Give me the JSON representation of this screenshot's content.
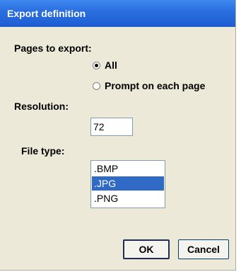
{
  "window": {
    "title": "Export definition"
  },
  "pages": {
    "label": "Pages to export:",
    "options": [
      {
        "label": "All",
        "selected": true
      },
      {
        "label": "Prompt on each page",
        "selected": false
      }
    ]
  },
  "resolution": {
    "label": "Resolution:",
    "value": "72"
  },
  "file_type": {
    "label": "File type:",
    "options": [
      ".BMP",
      ".JPG",
      ".PNG"
    ],
    "selected": ".JPG"
  },
  "buttons": {
    "ok": "OK",
    "cancel": "Cancel"
  },
  "colors": {
    "titlebar": "#2a6fe0",
    "selection": "#316ac5",
    "dialog_bg": "#ece9d8"
  }
}
